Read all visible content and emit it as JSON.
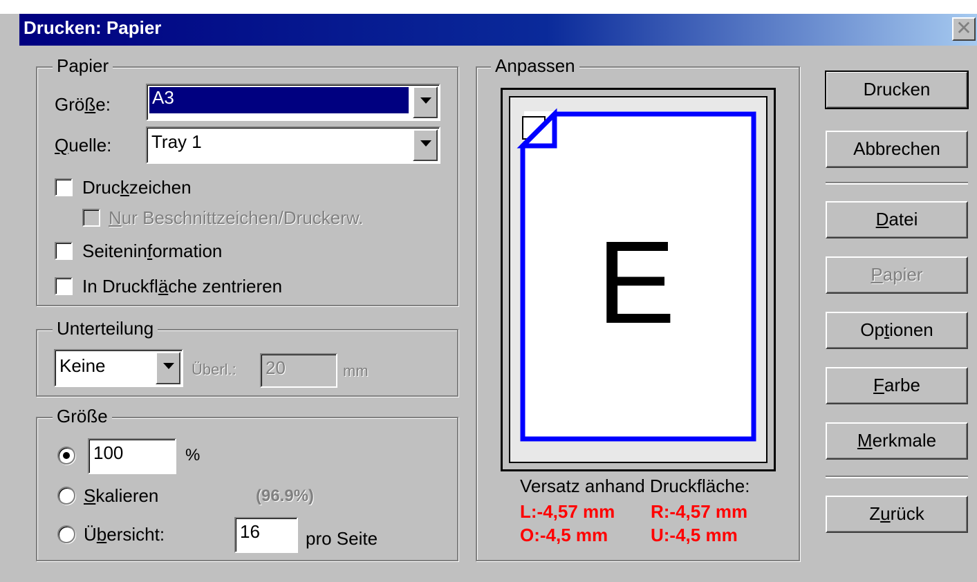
{
  "window": {
    "title": "Drucken: Papier",
    "close": "✕"
  },
  "papier_group": {
    "legend": "Papier",
    "groesse_label_pre": "Grö",
    "groesse_label_u": "ß",
    "groesse_label_post": "e:",
    "groesse_value": "A3",
    "quelle_label_u": "Q",
    "quelle_label_post": "uelle:",
    "quelle_value": "Tray 1",
    "druckzeichen_pre": "Druc",
    "druckzeichen_u": "k",
    "druckzeichen_post": "zeichen",
    "nur_u": "N",
    "nur_post": "ur Beschnittzeichen/Druckerw.",
    "seiteninfo_pre": "Seitenin",
    "seiteninfo_u": "f",
    "seiteninfo_post": "ormation",
    "zentrieren_pre": "In Druckfl",
    "zentrieren_u": "ä",
    "zentrieren_post": "che zentrieren"
  },
  "unterteilung_group": {
    "legend": "Unterteilung",
    "value": "Keine",
    "ueberl_label": "Überl.:",
    "ueberl_value": "20",
    "unit": "mm"
  },
  "groesse_group": {
    "legend": "Größe",
    "percent_value": "100",
    "percent_sign": "%",
    "skalieren_u": "S",
    "skalieren_post": "kalieren",
    "skalieren_value": "(96.9%)",
    "uebersicht_pre": "Ü",
    "uebersicht_u": "b",
    "uebersicht_post": "ersicht:",
    "uebersicht_value": "16",
    "pro_seite": "pro Seite"
  },
  "anpassen_group": {
    "legend": "Anpassen",
    "preview_letter": "E",
    "versatz_label": "Versatz anhand Druckfläche:",
    "offset_L": "L:-4,57 mm",
    "offset_R": "R:-4,57 mm",
    "offset_O": "O:-4,5 mm",
    "offset_U": "U:-4,5 mm"
  },
  "buttons": {
    "drucken": "Drucken",
    "abbrechen": "Abbrechen",
    "datei_u": "D",
    "datei_post": "atei",
    "papier_u": "P",
    "papier_post": "apier",
    "optionen_pre": "Op",
    "optionen_u": "t",
    "optionen_post": "ionen",
    "farbe_u": "F",
    "farbe_post": "arbe",
    "merkmale_u": "M",
    "merkmale_post": "erkmale",
    "zurueck_pre": "Z",
    "zurueck_u": "u",
    "zurueck_post": "rück"
  },
  "colors": {
    "titlebar": "#000080",
    "preview_border": "#0000ff",
    "offset_text": "#ff0000",
    "face": "#c0c0c0"
  }
}
